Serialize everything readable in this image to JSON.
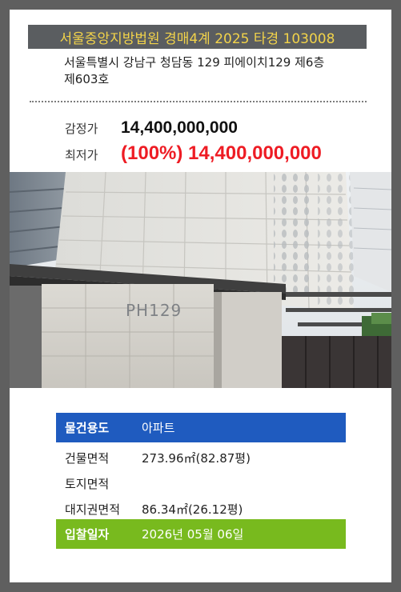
{
  "title": "서울중앙지방법원 경매4계 2025 타경 103008",
  "address_line1": "서울특별시 강남구 청담동 129 피에이치129 제6층",
  "address_line2": "제603호",
  "prices": {
    "appraisal_label": "감정가",
    "appraisal_value": "14,400,000,000",
    "minimum_label": "최저가",
    "minimum_value": "(100%) 14,400,000,000"
  },
  "photo": {
    "sign_text": "PH129"
  },
  "details": [
    {
      "label": "물건용도",
      "value": "아파트"
    },
    {
      "label": "건물면적",
      "value": "273.96㎡(82.87평)"
    },
    {
      "label": "토지면적",
      "value": ""
    },
    {
      "label": "대지권면적",
      "value": "86.34㎡(26.12평)"
    },
    {
      "label": "입찰일자",
      "value": "2026년 05월 06일"
    }
  ],
  "colors": {
    "frame": "#5f5f5f",
    "title_bg": "#5a5d60",
    "title_text": "#f2d34a",
    "minimum_price": "#ee1c24",
    "usage_bar": "#1f5bbf",
    "date_bar": "#78ba1e"
  }
}
